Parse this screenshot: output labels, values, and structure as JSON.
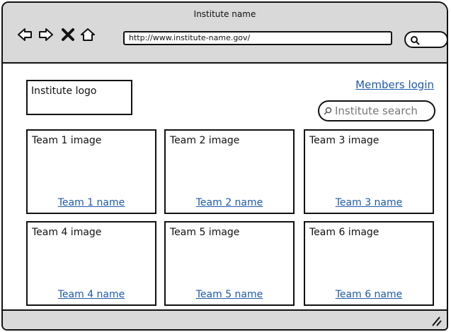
{
  "window": {
    "title": "Institute name"
  },
  "browser": {
    "url": "http://www.institute-name.gov/",
    "nav_icons": [
      "back-arrow-icon",
      "forward-arrow-icon",
      "close-x-icon",
      "home-icon"
    ]
  },
  "page": {
    "logo_text": "Institute logo",
    "members_login": "Members login",
    "search_placeholder": "Institute search",
    "teams": [
      {
        "image": "Team 1 image",
        "name": "Team 1 name"
      },
      {
        "image": "Team 2 image",
        "name": "Team 2 name"
      },
      {
        "image": "Team 3 image",
        "name": "Team 3 name"
      },
      {
        "image": "Team 4 image",
        "name": "Team 4 image",
        "name_label": "Team 4 name"
      },
      {
        "image": "Team 5 image",
        "name": "Team 5 name"
      },
      {
        "image": "Team 6 image",
        "name": "Team 6 name"
      }
    ]
  },
  "colors": {
    "link": "#1f5aa8",
    "chrome": "#d9d9d9"
  }
}
